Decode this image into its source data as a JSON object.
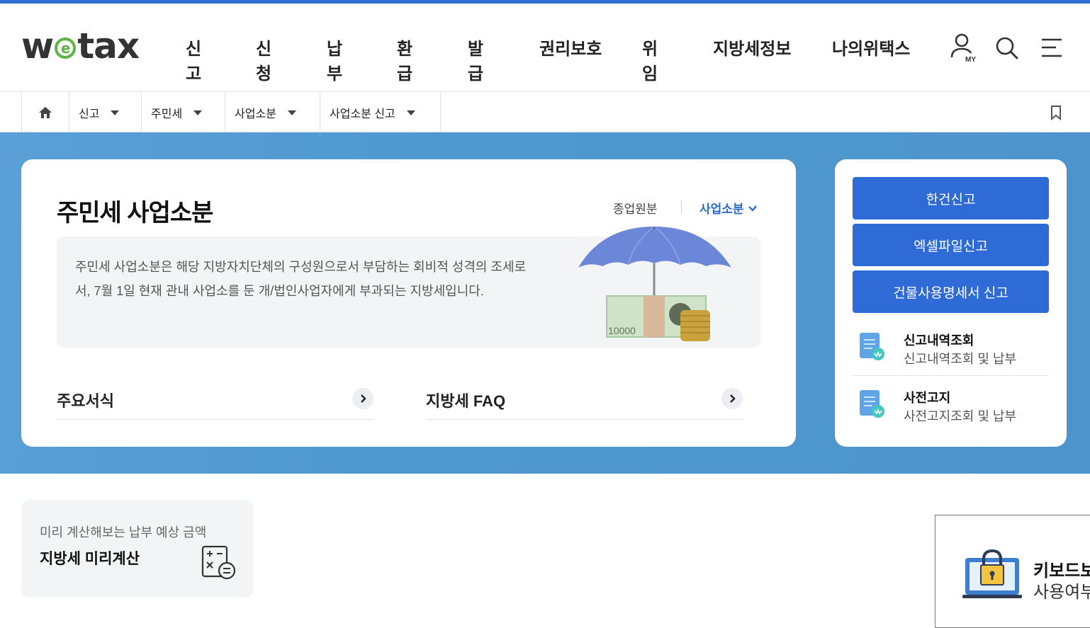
{
  "header": {
    "logo_prefix": "w",
    "logo_e": "e",
    "logo_suffix": "tax",
    "nav": [
      "신고",
      "신청",
      "납부",
      "환급",
      "발급",
      "권리보호",
      "위임",
      "지방세정보",
      "나의위택스"
    ],
    "my_badge": "MY",
    "icons": [
      "my-page-icon",
      "search-icon",
      "menu-icon"
    ]
  },
  "breadcrumb": {
    "items": [
      "신고",
      "주민세",
      "사업소분",
      "사업소분 신고"
    ],
    "icons": [
      "home-icon",
      "bookmark-icon"
    ]
  },
  "main": {
    "title": "주민세 사업소분",
    "switch": {
      "inactive": "종업원분",
      "active": "사업소분"
    },
    "description": "주민세 사업소분은 해당 지방자치단체의 구성원으로서 부담하는 회비적 성격의 조세로서, 7월 1일 현재 관내 사업소를 둔 개/법인사업자에게 부과되는 지방세입니다.",
    "illustration_text": "10000",
    "links": [
      "주요서식",
      "지방세 FAQ"
    ]
  },
  "side": {
    "buttons": [
      "한건신고",
      "엑셀파일신고",
      "건물사용명세서 신고"
    ],
    "quick": [
      {
        "title": "신고내역조회",
        "sub": "신고내역조회 및 납부"
      },
      {
        "title": "사전고지",
        "sub": "사전고지조회 및 납부"
      }
    ]
  },
  "calc": {
    "sub": "미리 계산해보는 납부 예상 금액",
    "title": "지방세 미리계산"
  },
  "keyboard_popup": {
    "line1": "키보드보",
    "line2": "사용여부"
  },
  "colors": {
    "primary": "#2f6bd6",
    "band": "#4f98d0",
    "logo_green": "#5db544"
  }
}
